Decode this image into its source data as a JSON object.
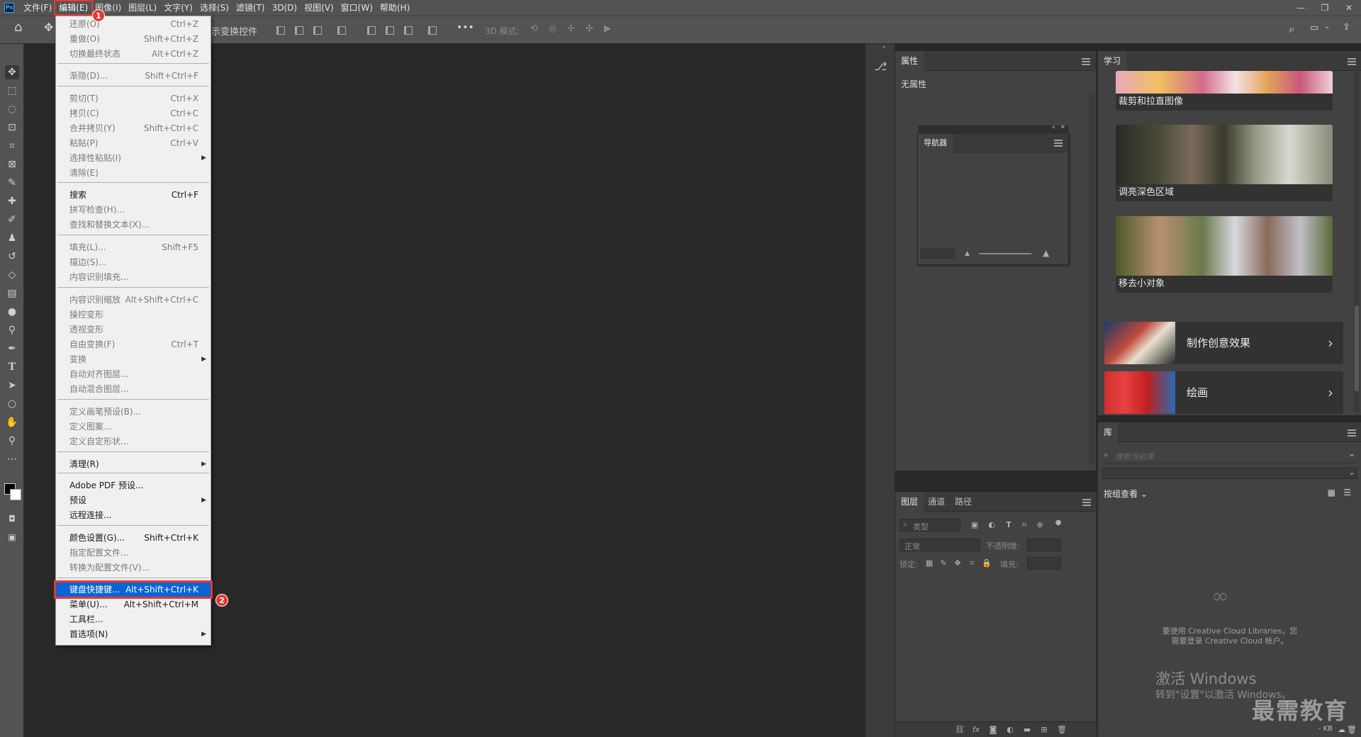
{
  "app": {
    "logo": "Ps"
  },
  "menubar": {
    "items": [
      "文件(F)",
      "编辑(E)",
      "图像(I)",
      "图层(L)",
      "文字(Y)",
      "选择(S)",
      "滤镜(T)",
      "3D(D)",
      "视图(V)",
      "窗口(W)",
      "帮助(H)"
    ],
    "active_index": 1
  },
  "window_controls": {
    "minimize": "—",
    "restore": "❐",
    "close": "✕"
  },
  "options_bar": {
    "transform_label": "示变换控件",
    "more": "•••",
    "mode_3d": "3D 模式:"
  },
  "edit_menu": {
    "items": [
      {
        "label": "还原(O)",
        "shortcut": "Ctrl+Z",
        "disabled": true
      },
      {
        "label": "重做(O)",
        "shortcut": "Shift+Ctrl+Z",
        "disabled": true
      },
      {
        "label": "切换最终状态",
        "shortcut": "Alt+Ctrl+Z",
        "disabled": true
      },
      {
        "label": "渐隐(D)...",
        "shortcut": "Shift+Ctrl+F",
        "disabled": true
      },
      {
        "label": "剪切(T)",
        "shortcut": "Ctrl+X",
        "disabled": true
      },
      {
        "label": "拷贝(C)",
        "shortcut": "Ctrl+C",
        "disabled": true
      },
      {
        "label": "合并拷贝(Y)",
        "shortcut": "Shift+Ctrl+C",
        "disabled": true
      },
      {
        "label": "粘贴(P)",
        "shortcut": "Ctrl+V",
        "disabled": true
      },
      {
        "label": "选择性粘贴(I)",
        "shortcut": "",
        "disabled": true,
        "submenu": true
      },
      {
        "label": "清除(E)",
        "shortcut": "",
        "disabled": true
      },
      {
        "label": "搜索",
        "shortcut": "Ctrl+F",
        "disabled": false
      },
      {
        "label": "拼写检查(H)...",
        "shortcut": "",
        "disabled": true
      },
      {
        "label": "查找和替换文本(X)...",
        "shortcut": "",
        "disabled": true
      },
      {
        "label": "填充(L)...",
        "shortcut": "Shift+F5",
        "disabled": true
      },
      {
        "label": "描边(S)...",
        "shortcut": "",
        "disabled": true
      },
      {
        "label": "内容识别填充...",
        "shortcut": "",
        "disabled": true
      },
      {
        "label": "内容识别缩放",
        "shortcut": "Alt+Shift+Ctrl+C",
        "disabled": true
      },
      {
        "label": "操控变形",
        "shortcut": "",
        "disabled": true
      },
      {
        "label": "透视变形",
        "shortcut": "",
        "disabled": true
      },
      {
        "label": "自由变换(F)",
        "shortcut": "Ctrl+T",
        "disabled": true
      },
      {
        "label": "变换",
        "shortcut": "",
        "disabled": true,
        "submenu": true
      },
      {
        "label": "自动对齐图层...",
        "shortcut": "",
        "disabled": true
      },
      {
        "label": "自动混合图层...",
        "shortcut": "",
        "disabled": true
      },
      {
        "label": "定义画笔预设(B)...",
        "shortcut": "",
        "disabled": true
      },
      {
        "label": "定义图案...",
        "shortcut": "",
        "disabled": true
      },
      {
        "label": "定义自定形状...",
        "shortcut": "",
        "disabled": true
      },
      {
        "label": "清理(R)",
        "shortcut": "",
        "disabled": false,
        "submenu": true
      },
      {
        "label": "Adobe PDF 预设...",
        "shortcut": "",
        "disabled": false
      },
      {
        "label": "预设",
        "shortcut": "",
        "disabled": false,
        "submenu": true
      },
      {
        "label": "远程连接...",
        "shortcut": "",
        "disabled": false
      },
      {
        "label": "颜色设置(G)...",
        "shortcut": "Shift+Ctrl+K",
        "disabled": false
      },
      {
        "label": "指定配置文件...",
        "shortcut": "",
        "disabled": true
      },
      {
        "label": "转换为配置文件(V)...",
        "shortcut": "",
        "disabled": true
      },
      {
        "label": "键盘快捷键...",
        "shortcut": "Alt+Shift+Ctrl+K",
        "disabled": false,
        "highlighted": true
      },
      {
        "label": "菜单(U)...",
        "shortcut": "Alt+Shift+Ctrl+M",
        "disabled": false
      },
      {
        "label": "工具栏...",
        "shortcut": "",
        "disabled": false
      },
      {
        "label": "首选项(N)",
        "shortcut": "",
        "disabled": false,
        "submenu": true
      }
    ],
    "badges": [
      "1",
      "2"
    ]
  },
  "properties_panel": {
    "tab": "属性",
    "content": "无属性"
  },
  "navigator_panel": {
    "tab": "导航器"
  },
  "learn_panel": {
    "tab": "学习",
    "cards": [
      "裁剪和拉直图像",
      "调亮深色区域",
      "移去小对象"
    ],
    "sections": [
      "制作创意效果",
      "绘画"
    ]
  },
  "layers_panel": {
    "tabs": [
      "图层",
      "通道",
      "路径"
    ],
    "filter_placeholder": "类型",
    "blend_mode": "正常",
    "opacity_label": "不透明度:",
    "lock_label": "锁定:",
    "fill_label": "填充:"
  },
  "library_panel": {
    "tab": "库",
    "search_placeholder": "搜索当前库",
    "group_view": "按组查看",
    "message_line1": "要使用 Creative Cloud Libraries，您",
    "message_line2": "需要登录 Creative Cloud 帐户。",
    "kb": "- KB"
  },
  "watermark": {
    "line1": "激活 Windows",
    "line2": "转到\"设置\"以激活 Windows。",
    "logo": "最需教育"
  },
  "colors": {
    "menu_bg": "#f0f0f0",
    "highlight": "#0a64d2",
    "annotation_red": "#e53935",
    "panel_bg": "#424242",
    "chrome_bg": "#535353",
    "canvas_bg": "#282828"
  }
}
